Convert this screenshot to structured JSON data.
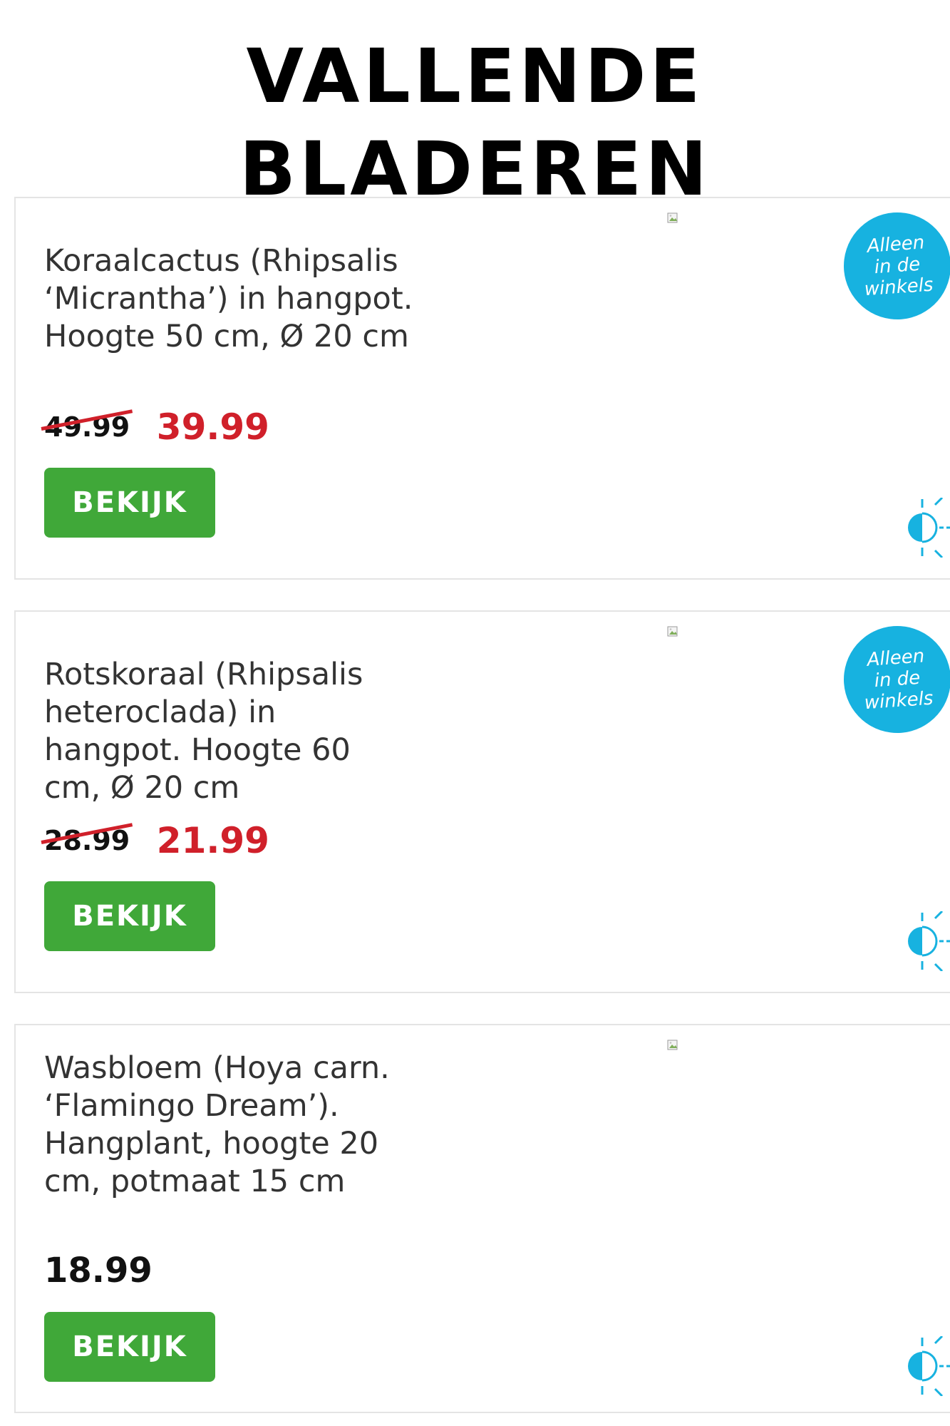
{
  "page": {
    "title": "VALLENDE BLADEREN"
  },
  "products": [
    {
      "description": "Koraalcactus (Rhipsalis ‘Micrantha’) in hangpot. Hoogte 50 cm, Ø 20 cm",
      "old_price": "49.99",
      "price": "39.99",
      "button_label": "BEKIJK",
      "badge": "Alleen\nin de\nwinkels",
      "light_icon": "half-sun-icon"
    },
    {
      "description": "Rotskoraal (Rhipsalis heteroclada) in hangpot. Hoogte 60 cm, Ø 20 cm",
      "old_price": "28.99",
      "price": "21.99",
      "button_label": "BEKIJK",
      "badge": "Alleen\nin de\nwinkels",
      "light_icon": "half-sun-icon"
    },
    {
      "description": "Wasbloem (Hoya carn. ‘Flamingo Dream’). Hangplant, hoogte 20 cm, potmaat 15 cm",
      "price": "18.99",
      "button_label": "BEKIJK",
      "light_icon": "half-sun-icon"
    }
  ],
  "colors": {
    "button_green": "#40a839",
    "sale_red": "#d0202a",
    "badge_blue": "#17b2e0",
    "icon_blue": "#17b2e0"
  }
}
